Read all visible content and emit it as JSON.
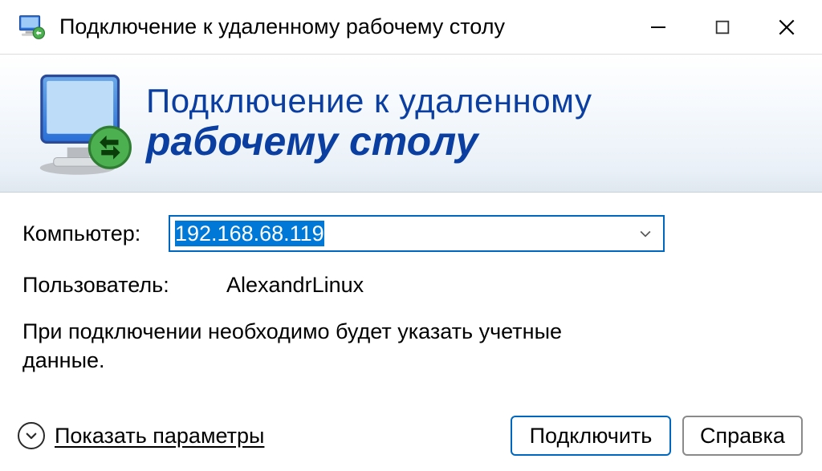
{
  "titlebar": {
    "title": "Подключение к удаленному рабочему столу"
  },
  "banner": {
    "line1": "Подключение к удаленному",
    "line2": "рабочему столу"
  },
  "labels": {
    "computer": "Компьютер:",
    "user": "Пользователь:"
  },
  "values": {
    "computer": "192.168.68.119",
    "user": "AlexandrLinux"
  },
  "hint": "При подключении необходимо будет указать учетные данные.",
  "footer": {
    "toggle": "Показать параметры",
    "connect": "Подключить",
    "help": "Справка"
  }
}
